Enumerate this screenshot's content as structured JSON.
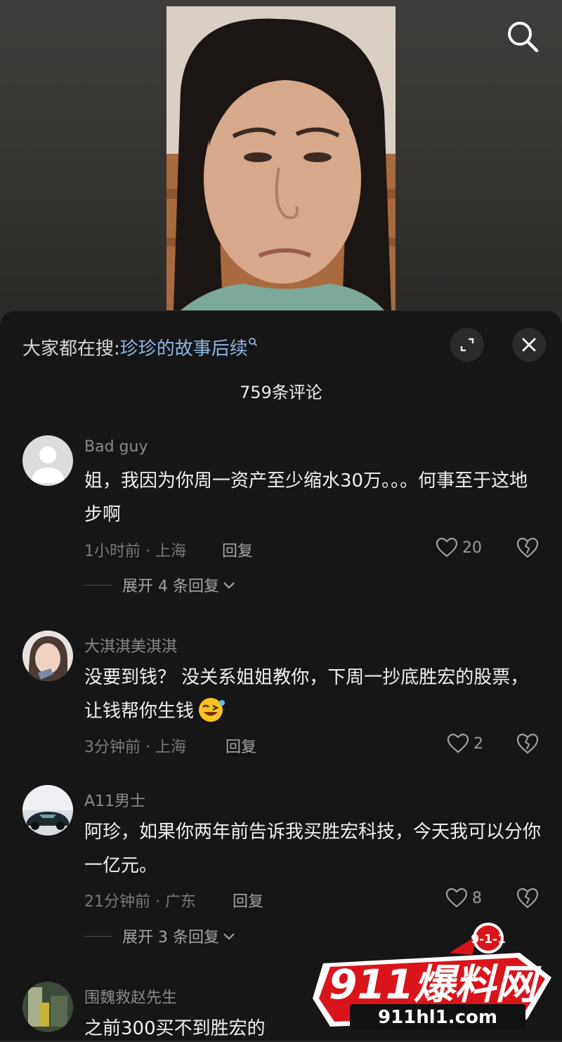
{
  "hot_search": {
    "prefix": "大家都在搜:",
    "keyword": "珍珍的故事后续"
  },
  "comment_count": "759条评论",
  "comments": [
    {
      "user": "Bad guy",
      "text": "姐，我因为你周一资产至少缩水30万。。。何事至于这地步啊",
      "time_loc": "1小时前 · 上海",
      "reply": "回复",
      "likes": "20",
      "expand": "展开 4 条回复"
    },
    {
      "user": "大淇淇美淇淇",
      "text": "没要到钱？ 没关系姐姐教你，下周一抄底胜宏的股票，让钱帮你生钱",
      "time_loc": "3分钟前 · 上海",
      "reply": "回复",
      "likes": "2"
    },
    {
      "user": "A11男士",
      "text": "阿珍，如果你两年前告诉我买胜宏科技，今天我可以分你一亿元。",
      "time_loc": "21分钟前 · 广东",
      "reply": "回复",
      "likes": "8",
      "expand": "展开 3 条回复"
    },
    {
      "user": "围魏救赵先生",
      "text": "之前300买不到胜宏的"
    }
  ],
  "watermark": {
    "badge": "9-1-1",
    "brand": "911爆料网",
    "url": "911hl1.com"
  },
  "colors": {
    "sheet_bg": "#161616",
    "keyword": "#8fb4e0",
    "watermark_red": "#d9151b"
  }
}
